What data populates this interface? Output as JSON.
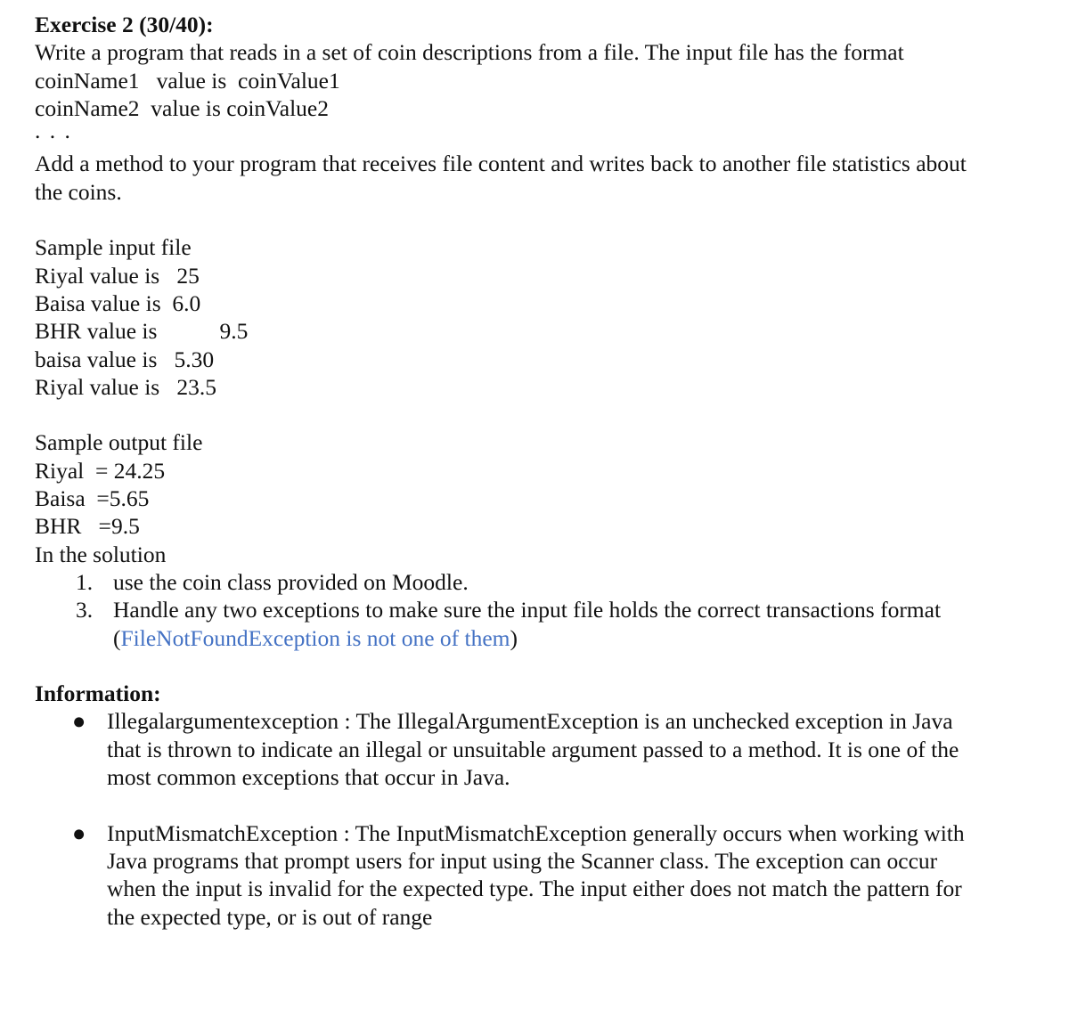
{
  "exercise": {
    "title": "Exercise 2 (30/40):",
    "intro": "Write a program that reads in a set of coin descriptions from a file. The input file has the format",
    "format_lines": [
      "coinName1   value is  coinValue1",
      "coinName2  value is coinValue2"
    ],
    "ellipsis": ". . .",
    "method_text_line1": "Add a method to your program that receives file content and writes back to another file statistics about",
    "method_text_line2": "the coins."
  },
  "sample_input": {
    "heading": "Sample input file",
    "lines": [
      "Riyal value is   25",
      "Baisa value is  6.0",
      "BHR value is           9.5",
      "baisa value is   5.30",
      "Riyal value is   23.5"
    ]
  },
  "sample_output": {
    "heading": "Sample output file",
    "lines": [
      "Riyal  = 24.25",
      "Baisa  =5.65",
      "BHR   =9.5"
    ]
  },
  "solution": {
    "heading": "In the solution",
    "items": [
      {
        "number": "1.",
        "text": "use the coin class provided on Moodle."
      },
      {
        "number": "3.",
        "text": "Handle any two exceptions to make sure the input file holds the correct transactions format",
        "note_open": "(",
        "note_highlight": "FileNotFoundException is not one of them",
        "note_close": ")"
      }
    ],
    "highlight_color": "#4472c4"
  },
  "information": {
    "heading": "Information:",
    "bullets": [
      {
        "symbol": "●",
        "text": "Illegalargumentexception : The IllegalArgumentException is an unchecked exception in Java\nthat is thrown to indicate an illegal or unsuitable argument passed to a method. It is one of the\nmost common exceptions that occur in Java."
      },
      {
        "symbol": "●",
        "text": "InputMismatchException : The InputMismatchException generally occurs when working with\nJava programs that prompt users for input using the Scanner class. The exception can occur\nwhen the input is invalid for the expected type. The input either does not match the pattern for\nthe expected type, or is out of range"
      }
    ]
  }
}
